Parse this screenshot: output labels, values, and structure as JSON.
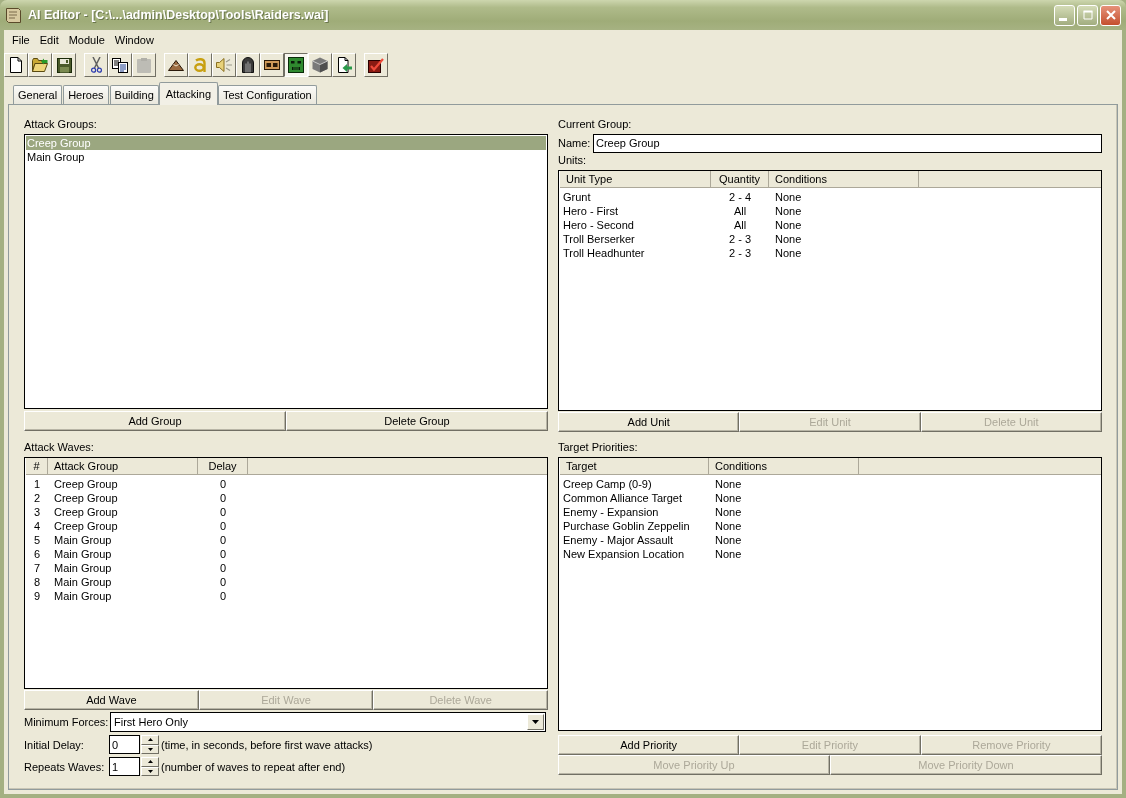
{
  "window": {
    "title": "AI Editor - [C:\\...\\admin\\Desktop\\Tools\\Raiders.wai]"
  },
  "menu": [
    {
      "label": "File"
    },
    {
      "label": "Edit"
    },
    {
      "label": "Module"
    },
    {
      "label": "Window"
    }
  ],
  "toolbar": [
    {
      "buttons": [
        {
          "disabled": false,
          "pressed": false
        },
        {
          "disabled": false,
          "pressed": false
        },
        {
          "disabled": false,
          "pressed": false
        }
      ]
    },
    {
      "buttons": [
        {
          "disabled": false,
          "pressed": false
        },
        {
          "disabled": false,
          "pressed": false
        },
        {
          "disabled": true,
          "pressed": false
        }
      ]
    },
    {
      "buttons": [
        {
          "disabled": false,
          "pressed": false
        },
        {
          "disabled": false,
          "pressed": false
        },
        {
          "disabled": false,
          "pressed": false
        },
        {
          "disabled": false,
          "pressed": false
        },
        {
          "disabled": false,
          "pressed": false
        },
        {
          "disabled": false,
          "pressed": true
        },
        {
          "disabled": false,
          "pressed": false
        },
        {
          "disabled": false,
          "pressed": false
        }
      ]
    },
    {
      "buttons": [
        {
          "disabled": false,
          "pressed": false
        }
      ]
    }
  ],
  "tabs": [
    {
      "label": "General",
      "selected": false
    },
    {
      "label": "Heroes",
      "selected": false
    },
    {
      "label": "Building",
      "selected": false
    },
    {
      "label": "Attacking",
      "selected": true
    },
    {
      "label": "Test Configuration",
      "selected": false
    }
  ],
  "attack_groups": {
    "label": "Attack Groups:",
    "items": [
      {
        "text": "Creep Group",
        "selected": true
      },
      {
        "text": "Main Group",
        "selected": false
      }
    ],
    "buttons": [
      {
        "label": "Add Group",
        "disabled": false
      },
      {
        "label": "Delete Group",
        "disabled": false
      }
    ]
  },
  "attack_waves": {
    "label": "Attack Waves:",
    "columns": [
      "#",
      "Attack Group",
      "Delay"
    ],
    "rows": [
      [
        "1",
        "Creep Group",
        "0"
      ],
      [
        "2",
        "Creep Group",
        "0"
      ],
      [
        "3",
        "Creep Group",
        "0"
      ],
      [
        "4",
        "Creep Group",
        "0"
      ],
      [
        "5",
        "Main Group",
        "0"
      ],
      [
        "6",
        "Main Group",
        "0"
      ],
      [
        "7",
        "Main Group",
        "0"
      ],
      [
        "8",
        "Main Group",
        "0"
      ],
      [
        "9",
        "Main Group",
        "0"
      ]
    ],
    "buttons": [
      {
        "label": "Add Wave",
        "disabled": false
      },
      {
        "label": "Edit Wave",
        "disabled": true
      },
      {
        "label": "Delete Wave",
        "disabled": true
      }
    ]
  },
  "minimum_forces": {
    "label": "Minimum Forces:",
    "value": "First Hero Only"
  },
  "initial_delay": {
    "label": "Initial Delay:",
    "value": "0",
    "hint": "(time, in seconds, before first wave attacks)"
  },
  "repeat_waves": {
    "label": "Repeats Waves:",
    "value": "1",
    "hint": "(number of waves to repeat after end)"
  },
  "current_group": {
    "label": "Current Group:",
    "name_label": "Name:",
    "name": "Creep Group",
    "units_label": "Units:",
    "columns": [
      "Unit Type",
      "Quantity",
      "Conditions"
    ],
    "rows": [
      [
        "Grunt",
        "2 - 4",
        "None"
      ],
      [
        "Hero - First",
        "All",
        "None"
      ],
      [
        "Hero - Second",
        "All",
        "None"
      ],
      [
        "Troll Berserker",
        "2 - 3",
        "None"
      ],
      [
        "Troll Headhunter",
        "2 - 3",
        "None"
      ]
    ],
    "buttons": [
      {
        "label": "Add Unit",
        "disabled": false
      },
      {
        "label": "Edit Unit",
        "disabled": true
      },
      {
        "label": "Delete Unit",
        "disabled": true
      }
    ]
  },
  "target_priorities": {
    "label": "Target Priorities:",
    "columns": [
      "Target",
      "Conditions"
    ],
    "rows": [
      [
        "Creep Camp (0-9)",
        "None"
      ],
      [
        "Common Alliance Target",
        "None"
      ],
      [
        "Enemy - Expansion",
        "None"
      ],
      [
        "Purchase Goblin Zeppelin",
        "None"
      ],
      [
        "Enemy - Major Assault",
        "None"
      ],
      [
        "New Expansion Location",
        "None"
      ]
    ],
    "button_rows": [
      {
        "buttons": [
          {
            "label": "Add Priority",
            "disabled": false
          },
          {
            "label": "Edit Priority",
            "disabled": true
          },
          {
            "label": "Remove Priority",
            "disabled": true
          }
        ]
      },
      {
        "buttons": [
          {
            "label": "Move Priority Up",
            "disabled": true
          },
          {
            "label": "Move Priority Down",
            "disabled": true
          }
        ]
      }
    ]
  }
}
